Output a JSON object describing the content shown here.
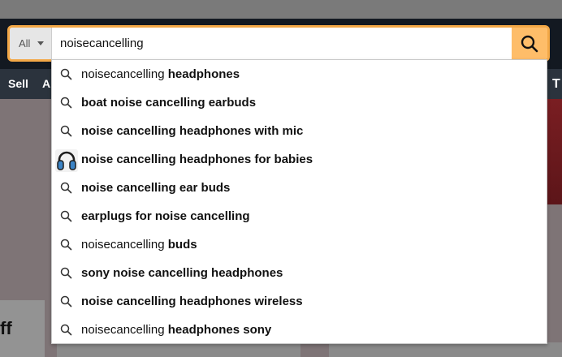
{
  "nav": {
    "sell": "Sell",
    "partial": "A",
    "right_partial": "T"
  },
  "promo": {
    "partial_text": "ff"
  },
  "search": {
    "scope_label": "All",
    "query": "noisecancelling"
  },
  "suggestions": [
    {
      "plain": "noisecancelling ",
      "bold": "headphones",
      "icon": "search-icon"
    },
    {
      "plain": "",
      "bold": "boat noise cancelling earbuds",
      "icon": "search-icon"
    },
    {
      "plain": "",
      "bold": "noise cancelling headphones with mic",
      "icon": "search-icon"
    },
    {
      "plain": "",
      "bold": "noise cancelling headphones for babies",
      "icon": "headphones-thumbnail"
    },
    {
      "plain": "",
      "bold": "noise cancelling ear buds",
      "icon": "search-icon"
    },
    {
      "plain": "",
      "bold": "earplugs for noise cancelling",
      "icon": "search-icon"
    },
    {
      "plain": "noisecancelling ",
      "bold": "buds",
      "icon": "search-icon"
    },
    {
      "plain": "",
      "bold": "sony noise cancelling headphones",
      "icon": "search-icon"
    },
    {
      "plain": "",
      "bold": "noise cancelling headphones wireless",
      "icon": "search-icon"
    },
    {
      "plain": "noisecancelling ",
      "bold": "headphones sony",
      "icon": "search-icon"
    }
  ],
  "colors": {
    "header": "#131921",
    "nav": "#2b333d",
    "search_border": "#f3a847",
    "search_button": "#febd69"
  }
}
